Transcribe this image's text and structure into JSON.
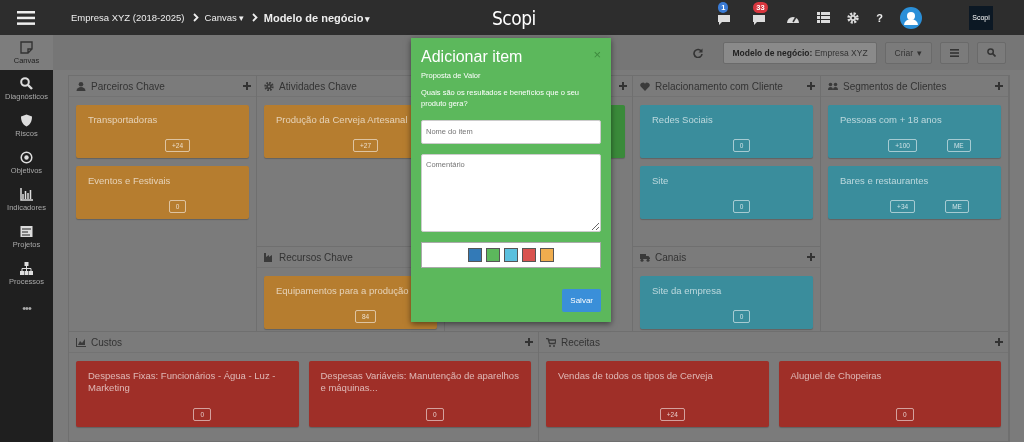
{
  "top_bar": {
    "breadcrumb": [
      {
        "label": "Empresa XYZ (2018-2025)"
      },
      {
        "label": "Canvas",
        "caret": "▾"
      },
      {
        "label": "Modelo de negócio",
        "caret": "▾"
      }
    ],
    "logo": "Scopi",
    "notifications": [
      {
        "count": "1",
        "color": "#3a7bd5"
      },
      {
        "count": "33",
        "color": "#d9363e"
      }
    ],
    "help": "?",
    "brand": "Scopi"
  },
  "sidebar": [
    {
      "label": "Canvas",
      "kind": "note",
      "selected": true
    },
    {
      "label": "Diagnósticos",
      "kind": "search",
      "selected": false
    },
    {
      "label": "Riscos",
      "kind": "shield",
      "selected": false
    },
    {
      "label": "Objetivos",
      "kind": "target",
      "selected": false
    },
    {
      "label": "Indicadores",
      "kind": "bars",
      "selected": false
    },
    {
      "label": "Projetos",
      "kind": "board",
      "selected": false
    },
    {
      "label": "Processos",
      "kind": "org",
      "selected": false
    }
  ],
  "sidebar_more": "•••",
  "toolbar": {
    "filter_label": "Modelo de negócio:",
    "filter_value": "Empresa XYZ",
    "create": "Criar",
    "create_caret": "▾"
  },
  "canvas": {
    "columns": [
      {
        "sections": [
          {
            "kind": "user",
            "title": "Parceiros Chave",
            "addable": true,
            "color": "#b67d2f",
            "cards": [
              {
                "text": "Transportadoras",
                "badges": [
                  "+24"
                ]
              },
              {
                "text": "Eventos e Festivais",
                "badges": [
                  "0"
                ]
              }
            ]
          }
        ]
      },
      {
        "sections": [
          {
            "kind": "gear",
            "title": "Atividades Chave",
            "color": "#b67d2f",
            "cards": [
              {
                "text": "Produção da Cerveja Artesanal",
                "badges": [
                  "+27"
                ]
              }
            ]
          },
          {
            "kind": "factory",
            "title": "Recursos Chave",
            "color": "#b67d2f",
            "cards": [
              {
                "text": "Equipamentos para a produção",
                "badges": [
                  "84"
                ]
              }
            ]
          }
        ]
      },
      {
        "sections": [
          {
            "kind": "covered",
            "addable": true,
            "color": "#3a8a3a"
          }
        ]
      },
      {
        "sections": [
          {
            "kind": "heart",
            "title": "Relacionamento com Cliente",
            "addable": true,
            "color": "#3a8d9c",
            "cards": [
              {
                "text": "Redes Sociais",
                "badges": [
                  "0"
                ]
              },
              {
                "text": "Site",
                "badges": [
                  "0"
                ]
              }
            ]
          },
          {
            "kind": "truck",
            "title": "Canais",
            "addable": true,
            "color": "#3a8d9c",
            "cards": [
              {
                "text": "Site da empresa",
                "badges": [
                  "0"
                ]
              }
            ]
          }
        ]
      },
      {
        "sections": [
          {
            "kind": "group",
            "title": "Segmentos de Clientes",
            "addable": true,
            "color": "#3a8d9c",
            "cards": [
              {
                "text": "Pessoas com + 18 anos",
                "badges": [
                  "+100",
                  "ME"
                ]
              },
              {
                "text": "Bares e restaurantes",
                "badges": [
                  "+34",
                  "ME"
                ]
              }
            ]
          }
        ]
      }
    ],
    "bottom": [
      {
        "kind": "chart",
        "title": "Custos",
        "color": "#9f2f28",
        "cards": [
          {
            "text": "Despesas Fixas: Funcionários - Água - Luz - Marketing",
            "badges": [
              "0"
            ]
          },
          {
            "text": "Despesas Variáveis: Manutenção de aparelhos e máquinas...",
            "badges": [
              "0"
            ]
          }
        ]
      },
      {
        "kind": "cart",
        "title": "Receitas",
        "color": "#9f2f28",
        "cards": [
          {
            "text": "Vendas de todos os tipos de Cerveja",
            "badges": [
              "+24"
            ]
          },
          {
            "text": "Aluguel de Chopeiras",
            "badges": [
              "0"
            ]
          }
        ]
      }
    ]
  },
  "modal": {
    "title": "Adicionar item",
    "close": "×",
    "subtitle": "Proposta de Valor",
    "question": "Quais são os resultados e benefícios que o seu produto gera?",
    "name_placeholder": "Nome do item",
    "comment_placeholder": "Comentário",
    "colors": [
      {
        "color": "#337ab7"
      },
      {
        "color": "#5cb85c"
      },
      {
        "color": "#5bc0de"
      },
      {
        "color": "#d9534f"
      },
      {
        "color": "#f0ad4e"
      }
    ],
    "save": "Salvar"
  }
}
